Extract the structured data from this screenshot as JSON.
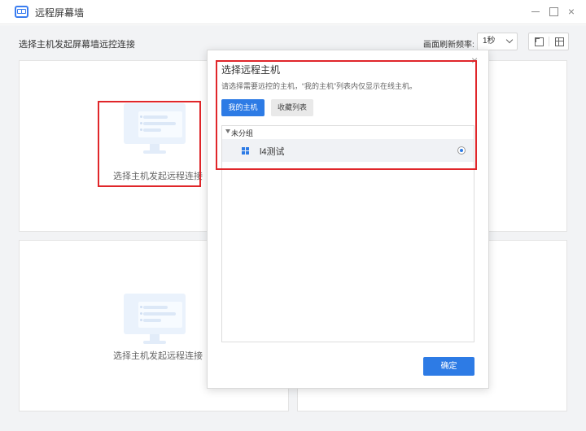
{
  "window": {
    "title": "远程屏幕墙",
    "app_icon": "screen-wall-icon",
    "controls": [
      "minimize-icon",
      "maximize-icon",
      "close-icon"
    ]
  },
  "toolbar": {
    "section_title": "选择主机发起屏幕墙远控连接",
    "refresh_label": "画面刷新频率:",
    "refresh_value": "1秒",
    "layout_buttons": [
      "single-screen-icon",
      "grid-layout-icon"
    ]
  },
  "panes": [
    {
      "placeholder_text": "选择主机发起远程连接"
    },
    {
      "placeholder_text": ""
    },
    {
      "placeholder_text": "选择主机发起远程连接"
    },
    {
      "placeholder_text": ""
    }
  ],
  "dialog": {
    "title": "选择远程主机",
    "hint": "请选择需要远控的主机，“我的主机”列表内仅显示在线主机。",
    "tabs": [
      {
        "label": "我的主机",
        "active": true
      },
      {
        "label": "收藏列表",
        "active": false
      }
    ],
    "group": {
      "label": "未分组",
      "expanded": true
    },
    "hosts": [
      {
        "name": "l4测试",
        "icon": "windows-icon",
        "selected": true
      }
    ],
    "confirm_label": "确定",
    "close_glyph": "×"
  },
  "colors": {
    "accent": "#2d7be5",
    "highlight_box": "#e0262a",
    "background": "#f2f3f5"
  }
}
